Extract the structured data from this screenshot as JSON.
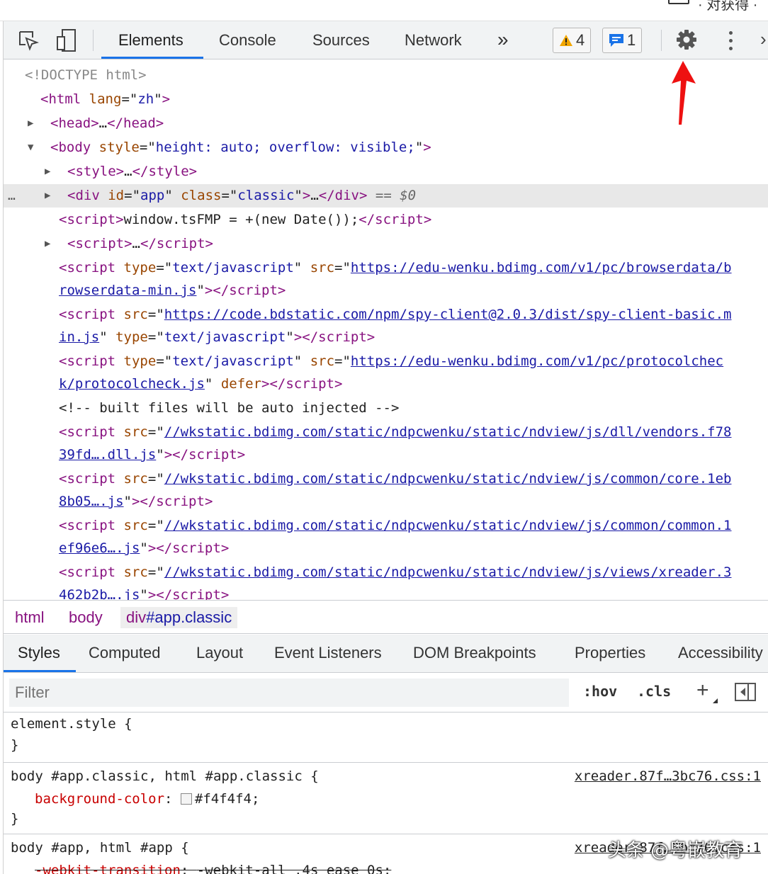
{
  "top_strip": {
    "text": "· 对获得 ·"
  },
  "toolbar": {
    "icons": [
      "inspect-element-icon",
      "device-toolbar-icon",
      "settings-gear-icon",
      "more-options-icon"
    ],
    "tabs": [
      "Elements",
      "Console",
      "Sources",
      "Network"
    ],
    "active_tab": "Elements",
    "more_tabs": "»",
    "warnings_count": "4",
    "messages_count": "1",
    "accent_color": "#1a73e8",
    "annotation": "red-arrow-pointing-at-settings"
  },
  "dom_tree": {
    "doctype": "<!DOCTYPE html>",
    "html_open": {
      "tag": "html",
      "attr": "lang",
      "value": "zh"
    },
    "head": {
      "tag": "head",
      "ellipsis": "…"
    },
    "body_open": {
      "tag": "body",
      "attr": "style",
      "value": "height: auto; overflow: visible;"
    },
    "style": {
      "tag": "style",
      "ellipsis": "…"
    },
    "div_app": {
      "tag": "div",
      "attr1": "id",
      "val1": "app",
      "attr2": "class",
      "val2": "classic",
      "ellipsis": "…",
      "marker": "== $0",
      "gutter": "…"
    },
    "script_inline": {
      "tag": "script",
      "code": "window.tsFMP = +(new Date());"
    },
    "script_collapsed": {
      "tag": "script",
      "ellipsis": "…"
    },
    "script_1": {
      "attr_a": "type",
      "val_a": "text/javascript",
      "attr_b": "src",
      "src_line1": "https://edu-wenku.bdimg.com/v1/pc/browserdata/b",
      "src_line2": "rowserdata-min.js"
    },
    "script_2": {
      "attr_a": "src",
      "src_line1": "https://code.bdstatic.com/npm/spy-client@2.0.3/dist/spy-client-basic.m",
      "src_line2": "in.js",
      "attr_b": "type",
      "val_b": "text/javascript"
    },
    "script_3": {
      "attr_a": "type",
      "val_a": "text/javascript",
      "attr_b": "src",
      "src_line1": "https://edu-wenku.bdimg.com/v1/pc/protocolchec",
      "src_line2": "k/protocolcheck.js",
      "attr_c": "defer"
    },
    "comment": "<!-- built files will be auto injected -->",
    "script_4": {
      "attr": "src",
      "src_line1": "//wkstatic.bdimg.com/static/ndpcwenku/static/ndview/js/dll/vendors.f78",
      "src_line2": "39fd….dll.js"
    },
    "script_5": {
      "attr": "src",
      "src_line1": "//wkstatic.bdimg.com/static/ndpcwenku/static/ndview/js/common/core.1eb",
      "src_line2": "8b05….js"
    },
    "script_6": {
      "attr": "src",
      "src_line1": "//wkstatic.bdimg.com/static/ndpcwenku/static/ndview/js/common/common.1",
      "src_line2": "ef96e6….js"
    },
    "script_7": {
      "attr": "src",
      "src_line1": "//wkstatic.bdimg.com/static/ndpcwenku/static/ndview/js/views/xreader.3",
      "src_line2": "462b2b….js"
    }
  },
  "breadcrumbs": {
    "items": [
      "html",
      "body"
    ],
    "active_tag": "div",
    "active_suffix": "#app.classic"
  },
  "panel_tabs": {
    "items": [
      "Styles",
      "Computed",
      "Layout",
      "Event Listeners",
      "DOM Breakpoints",
      "Properties",
      "Accessibility"
    ],
    "active": "Styles"
  },
  "filter": {
    "placeholder": "Filter",
    "hov": ":hov",
    "cls": ".cls",
    "plus": "+"
  },
  "rules": [
    {
      "selector": "element.style {",
      "close": "}"
    },
    {
      "selector": "body #app.classic, html #app.classic {",
      "source": "xreader.87f…3bc76.css:1",
      "property": "background-color",
      "value": "#f4f4f4;",
      "swatch": "#f4f4f4",
      "close": "}"
    },
    {
      "selector": "body #app, html #app {",
      "source": "xreader.87f…3bc76.css:1",
      "property": "-webkit-transition",
      "value": "-webkit-all .4s ease 0s;"
    }
  ],
  "watermark": "头条 @粤嵌教育"
}
